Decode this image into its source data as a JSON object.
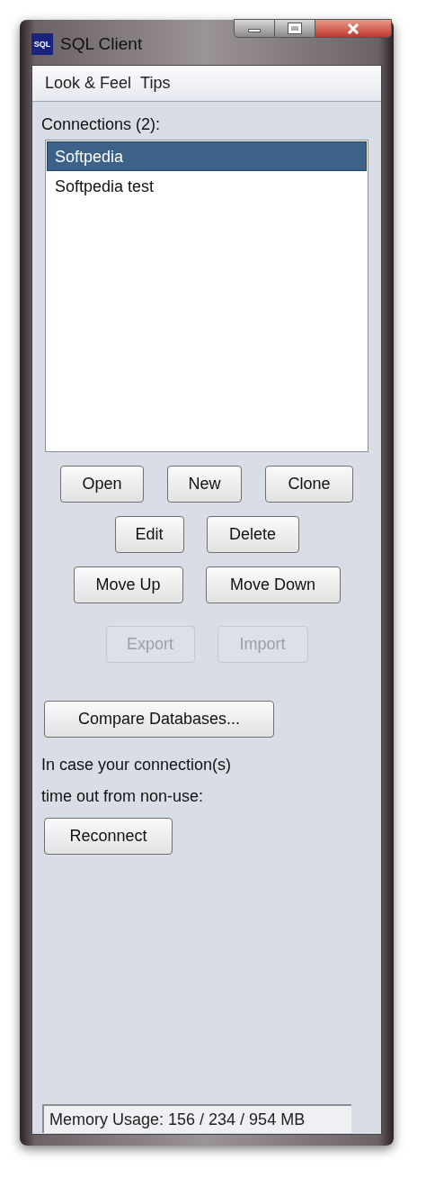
{
  "window": {
    "title": "SQL Client",
    "icon_text": "SQL"
  },
  "menu": [
    "Look & Feel",
    "Tips"
  ],
  "connections": {
    "label": "Connections (2):",
    "items": [
      {
        "label": "Softpedia",
        "selected": true
      },
      {
        "label": "Softpedia test",
        "selected": false
      }
    ]
  },
  "button_rows": [
    [
      {
        "label": "Open",
        "disabled": false
      },
      {
        "label": "New",
        "disabled": false
      },
      {
        "label": "Clone",
        "disabled": false
      }
    ],
    [
      {
        "label": "Edit",
        "disabled": false
      },
      {
        "label": "Delete",
        "disabled": false
      }
    ],
    [
      {
        "label": "Move Up",
        "disabled": false
      },
      {
        "label": "Move Down",
        "disabled": false
      }
    ],
    [
      {
        "label": "Export",
        "disabled": true
      },
      {
        "label": "Import",
        "disabled": true
      }
    ]
  ],
  "compare_button": "Compare Databases...",
  "reconnect_note": [
    "In case your connection(s)",
    "time out from non-use:"
  ],
  "reconnect_button": "Reconnect",
  "status_bar": "Memory Usage: 156 / 234 / 954 MB"
}
